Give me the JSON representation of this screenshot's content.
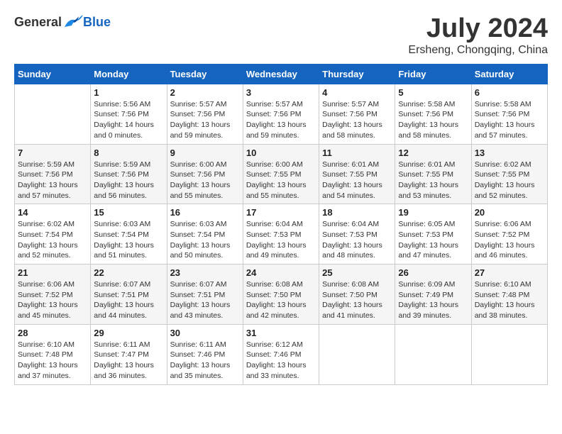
{
  "logo": {
    "text_general": "General",
    "text_blue": "Blue"
  },
  "title": "July 2024",
  "subtitle": "Ersheng, Chongqing, China",
  "days_of_week": [
    "Sunday",
    "Monday",
    "Tuesday",
    "Wednesday",
    "Thursday",
    "Friday",
    "Saturday"
  ],
  "weeks": [
    [
      {
        "day": "",
        "info": ""
      },
      {
        "day": "1",
        "info": "Sunrise: 5:56 AM\nSunset: 7:56 PM\nDaylight: 14 hours\nand 0 minutes."
      },
      {
        "day": "2",
        "info": "Sunrise: 5:57 AM\nSunset: 7:56 PM\nDaylight: 13 hours\nand 59 minutes."
      },
      {
        "day": "3",
        "info": "Sunrise: 5:57 AM\nSunset: 7:56 PM\nDaylight: 13 hours\nand 59 minutes."
      },
      {
        "day": "4",
        "info": "Sunrise: 5:57 AM\nSunset: 7:56 PM\nDaylight: 13 hours\nand 58 minutes."
      },
      {
        "day": "5",
        "info": "Sunrise: 5:58 AM\nSunset: 7:56 PM\nDaylight: 13 hours\nand 58 minutes."
      },
      {
        "day": "6",
        "info": "Sunrise: 5:58 AM\nSunset: 7:56 PM\nDaylight: 13 hours\nand 57 minutes."
      }
    ],
    [
      {
        "day": "7",
        "info": "Sunrise: 5:59 AM\nSunset: 7:56 PM\nDaylight: 13 hours\nand 57 minutes."
      },
      {
        "day": "8",
        "info": "Sunrise: 5:59 AM\nSunset: 7:56 PM\nDaylight: 13 hours\nand 56 minutes."
      },
      {
        "day": "9",
        "info": "Sunrise: 6:00 AM\nSunset: 7:56 PM\nDaylight: 13 hours\nand 55 minutes."
      },
      {
        "day": "10",
        "info": "Sunrise: 6:00 AM\nSunset: 7:55 PM\nDaylight: 13 hours\nand 55 minutes."
      },
      {
        "day": "11",
        "info": "Sunrise: 6:01 AM\nSunset: 7:55 PM\nDaylight: 13 hours\nand 54 minutes."
      },
      {
        "day": "12",
        "info": "Sunrise: 6:01 AM\nSunset: 7:55 PM\nDaylight: 13 hours\nand 53 minutes."
      },
      {
        "day": "13",
        "info": "Sunrise: 6:02 AM\nSunset: 7:55 PM\nDaylight: 13 hours\nand 52 minutes."
      }
    ],
    [
      {
        "day": "14",
        "info": "Sunrise: 6:02 AM\nSunset: 7:54 PM\nDaylight: 13 hours\nand 52 minutes."
      },
      {
        "day": "15",
        "info": "Sunrise: 6:03 AM\nSunset: 7:54 PM\nDaylight: 13 hours\nand 51 minutes."
      },
      {
        "day": "16",
        "info": "Sunrise: 6:03 AM\nSunset: 7:54 PM\nDaylight: 13 hours\nand 50 minutes."
      },
      {
        "day": "17",
        "info": "Sunrise: 6:04 AM\nSunset: 7:53 PM\nDaylight: 13 hours\nand 49 minutes."
      },
      {
        "day": "18",
        "info": "Sunrise: 6:04 AM\nSunset: 7:53 PM\nDaylight: 13 hours\nand 48 minutes."
      },
      {
        "day": "19",
        "info": "Sunrise: 6:05 AM\nSunset: 7:53 PM\nDaylight: 13 hours\nand 47 minutes."
      },
      {
        "day": "20",
        "info": "Sunrise: 6:06 AM\nSunset: 7:52 PM\nDaylight: 13 hours\nand 46 minutes."
      }
    ],
    [
      {
        "day": "21",
        "info": "Sunrise: 6:06 AM\nSunset: 7:52 PM\nDaylight: 13 hours\nand 45 minutes."
      },
      {
        "day": "22",
        "info": "Sunrise: 6:07 AM\nSunset: 7:51 PM\nDaylight: 13 hours\nand 44 minutes."
      },
      {
        "day": "23",
        "info": "Sunrise: 6:07 AM\nSunset: 7:51 PM\nDaylight: 13 hours\nand 43 minutes."
      },
      {
        "day": "24",
        "info": "Sunrise: 6:08 AM\nSunset: 7:50 PM\nDaylight: 13 hours\nand 42 minutes."
      },
      {
        "day": "25",
        "info": "Sunrise: 6:08 AM\nSunset: 7:50 PM\nDaylight: 13 hours\nand 41 minutes."
      },
      {
        "day": "26",
        "info": "Sunrise: 6:09 AM\nSunset: 7:49 PM\nDaylight: 13 hours\nand 39 minutes."
      },
      {
        "day": "27",
        "info": "Sunrise: 6:10 AM\nSunset: 7:48 PM\nDaylight: 13 hours\nand 38 minutes."
      }
    ],
    [
      {
        "day": "28",
        "info": "Sunrise: 6:10 AM\nSunset: 7:48 PM\nDaylight: 13 hours\nand 37 minutes."
      },
      {
        "day": "29",
        "info": "Sunrise: 6:11 AM\nSunset: 7:47 PM\nDaylight: 13 hours\nand 36 minutes."
      },
      {
        "day": "30",
        "info": "Sunrise: 6:11 AM\nSunset: 7:46 PM\nDaylight: 13 hours\nand 35 minutes."
      },
      {
        "day": "31",
        "info": "Sunrise: 6:12 AM\nSunset: 7:46 PM\nDaylight: 13 hours\nand 33 minutes."
      },
      {
        "day": "",
        "info": ""
      },
      {
        "day": "",
        "info": ""
      },
      {
        "day": "",
        "info": ""
      }
    ]
  ]
}
